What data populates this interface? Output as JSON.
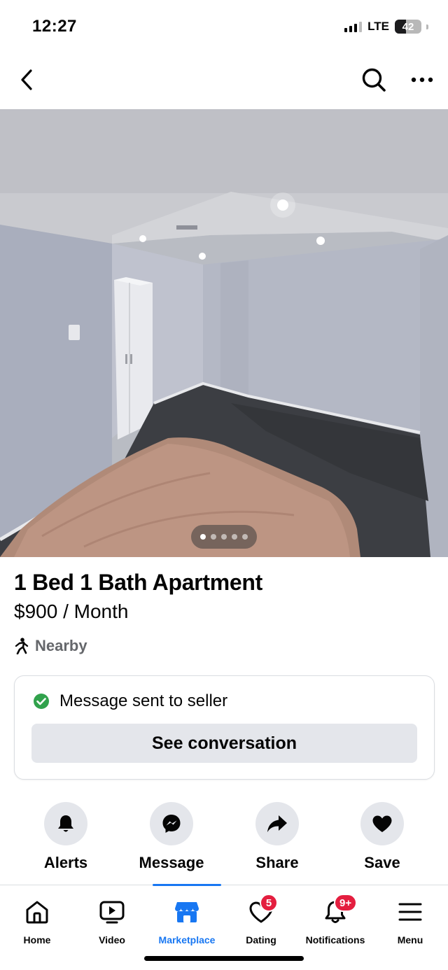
{
  "status_bar": {
    "time": "12:27",
    "network": "LTE",
    "battery": "42"
  },
  "top_nav": {
    "back_icon": "chevron-left-icon",
    "search_icon": "search-icon",
    "more_icon": "more-icon"
  },
  "photo": {
    "description_icon": "listing-photo",
    "page_count": 5,
    "active_page": 1
  },
  "listing": {
    "title": "1 Bed 1 Bath Apartment",
    "price": "$900 / Month",
    "location": "Nearby"
  },
  "message_card": {
    "status": "Message sent to seller",
    "button_label": "See conversation"
  },
  "actions": [
    {
      "label": "Alerts",
      "icon": "bell-icon"
    },
    {
      "label": "Message",
      "icon": "messenger-icon"
    },
    {
      "label": "Share",
      "icon": "share-icon"
    },
    {
      "label": "Save",
      "icon": "heart-icon"
    }
  ],
  "tabs": [
    {
      "label": "Home",
      "icon": "home-icon"
    },
    {
      "label": "Video",
      "icon": "video-icon"
    },
    {
      "label": "Marketplace",
      "icon": "marketplace-icon",
      "active": true
    },
    {
      "label": "Dating",
      "icon": "dating-icon",
      "badge": "5"
    },
    {
      "label": "Notifications",
      "icon": "bell-icon",
      "badge": "9+"
    },
    {
      "label": "Menu",
      "icon": "menu-icon"
    }
  ],
  "colors": {
    "accent": "#1877f2",
    "badge": "#e41e3f",
    "success": "#31a24c",
    "secondary_text": "#65676b",
    "button_bg": "#e4e6eb"
  }
}
